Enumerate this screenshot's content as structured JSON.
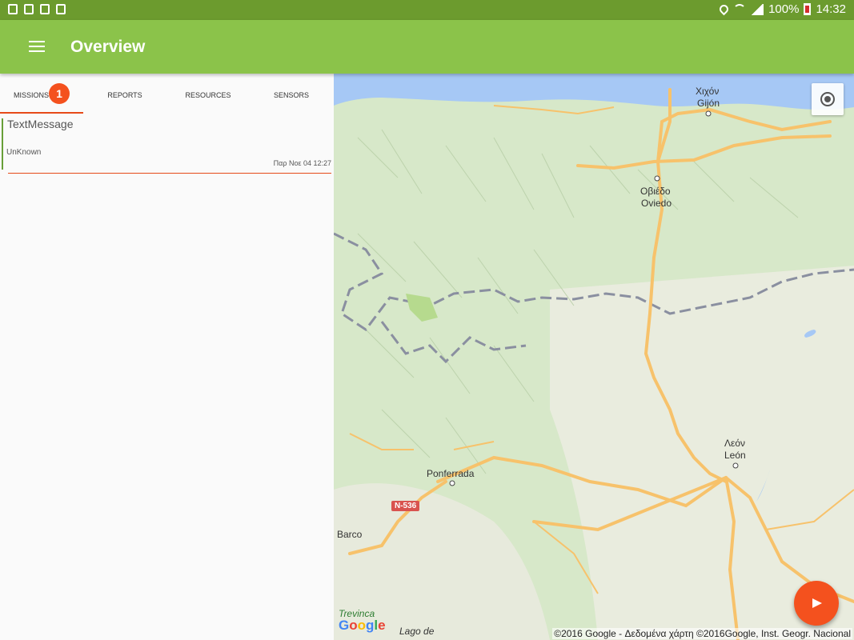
{
  "status_bar": {
    "battery": "100%",
    "time": "14:32"
  },
  "app_bar": {
    "title": "Overview"
  },
  "tabs": [
    {
      "label": "MISSIONS",
      "badge": "1"
    },
    {
      "label": "REPORTS"
    },
    {
      "label": "RESOURCES"
    },
    {
      "label": "SENSORS"
    }
  ],
  "mission_card": {
    "title": "TextMessage",
    "subtitle": "UnKnown",
    "timestamp": "Παρ Νοε 04 12:27"
  },
  "map": {
    "labels": {
      "gijon_gr": "Χιχόν",
      "gijon": "Gijón",
      "oviedo_gr": "Οβιέδο",
      "oviedo": "Oviedo",
      "leon_gr": "Λεόν",
      "leon": "León",
      "ponferrada": "Ponferrada",
      "barco": "Barco",
      "trevinca": "Trevinca",
      "lago": "Lago de"
    },
    "road_sign": "N-536",
    "logo": "Google",
    "copyright": "©2016 Google - Δεδομένα χάρτη ©2016Google, Inst. Geogr. Nacional"
  },
  "colors": {
    "status_bar": "#6c9b2e",
    "app_bar": "#8bc34a",
    "accent": "#f4511e",
    "card_bar": "#689f38"
  }
}
